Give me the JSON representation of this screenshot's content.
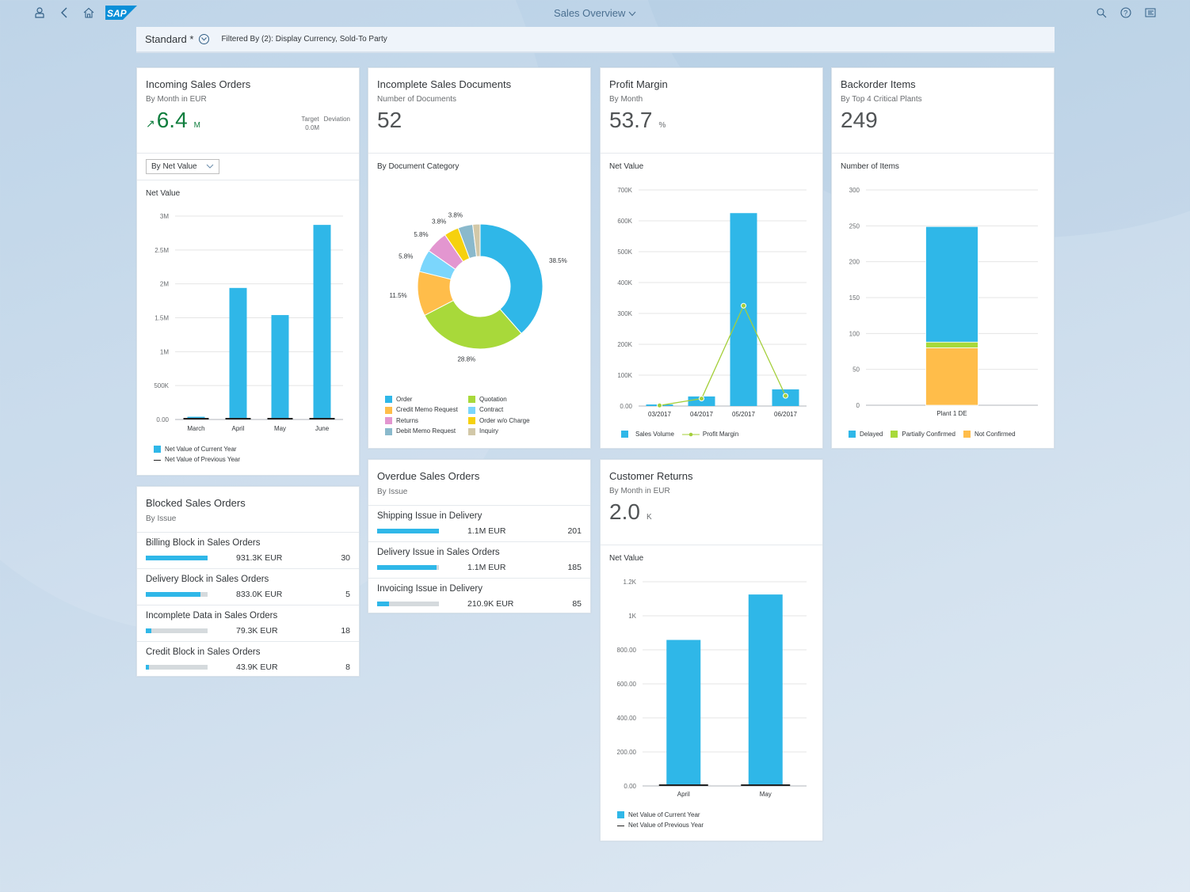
{
  "shell": {
    "title": "Sales Overview",
    "icons": [
      "user-icon",
      "back-icon",
      "home-icon",
      "search-icon",
      "help-icon",
      "notifications-icon"
    ],
    "logo": "SAP"
  },
  "filterbar": {
    "variant": "Standard *",
    "filtered_by": "Filtered By (2): Display Currency, Sold-To Party"
  },
  "colors": {
    "accent": "#2fb7e8",
    "positive": "#107e3e",
    "line_green": "#a4cf3a",
    "orange": "#ffbd4a"
  },
  "cards": {
    "incoming": {
      "title": "Incoming Sales Orders",
      "subtitle": "By Month in EUR",
      "kpi": "6.4",
      "unit": "M",
      "trend": "up",
      "target_label": "Target",
      "deviation_label": "Deviation",
      "target_value": "0.0M",
      "dropdown": "By Net Value",
      "chart_label": "Net Value",
      "legend_current": "Net Value of Current Year",
      "legend_previous": "Net Value of Previous Year"
    },
    "incomplete": {
      "title": "Incomplete Sales Documents",
      "subtitle": "Number of Documents",
      "kpi": "52",
      "chart_label": "By Document Category"
    },
    "profit": {
      "title": "Profit Margin",
      "subtitle": "By Month",
      "kpi": "53.7",
      "unit": "%",
      "chart_label": "Net Value"
    },
    "backorder": {
      "title": "Backorder Items",
      "subtitle": "By Top 4 Critical Plants",
      "kpi": "249",
      "chart_label": "Number of Items"
    },
    "blocked": {
      "title": "Blocked Sales Orders",
      "subtitle": "By Issue",
      "items": [
        {
          "label": "Billing Block in Sales Orders",
          "value": "931.3K EUR",
          "count": "30",
          "fraction": 1.0
        },
        {
          "label": "Delivery Block in Sales Orders",
          "value": "833.0K EUR",
          "count": "5",
          "fraction": 0.89
        },
        {
          "label": "Incomplete Data in Sales Orders",
          "value": "79.3K EUR",
          "count": "18",
          "fraction": 0.085
        },
        {
          "label": "Credit Block in Sales Orders",
          "value": "43.9K EUR",
          "count": "8",
          "fraction": 0.047
        }
      ]
    },
    "overdue": {
      "title": "Overdue Sales Orders",
      "subtitle": "By Issue",
      "items": [
        {
          "label": "Shipping Issue in Delivery",
          "value": "1.1M EUR",
          "count": "201",
          "fraction": 1.0
        },
        {
          "label": "Delivery Issue in Sales Orders",
          "value": "1.1M EUR",
          "count": "185",
          "fraction": 0.96
        },
        {
          "label": "Invoicing Issue in Delivery",
          "value": "210.9K EUR",
          "count": "85",
          "fraction": 0.19
        }
      ]
    },
    "returns": {
      "title": "Customer Returns",
      "subtitle": "By Month in EUR",
      "kpi": "2.0",
      "unit": "K",
      "chart_label": "Net Value",
      "legend_current": "Net Value of Current Year",
      "legend_previous": "Net Value of Previous Year"
    }
  },
  "chart_data": [
    {
      "id": "incoming",
      "type": "bar",
      "title": "Net Value",
      "categories": [
        "March",
        "April",
        "May",
        "June"
      ],
      "series": [
        {
          "name": "Net Value of Current Year",
          "values": [
            40000,
            1940000,
            1540000,
            2870000
          ],
          "color": "#2fb7e8"
        },
        {
          "name": "Net Value of Previous Year",
          "values": [
            0,
            0,
            0,
            0
          ],
          "color": "#222222"
        }
      ],
      "yticks": [
        "0.00",
        "500K",
        "1M",
        "1.5M",
        "2M",
        "2.5M",
        "3M"
      ],
      "ylim": [
        0,
        3000000
      ],
      "grid": true
    },
    {
      "id": "incomplete",
      "type": "pie",
      "title": "By Document Category",
      "slices": [
        {
          "name": "Order",
          "value": 38.5,
          "label": "38.5%",
          "color": "#2fb7e8"
        },
        {
          "name": "Quotation",
          "value": 28.8,
          "label": "28.8%",
          "color": "#a8d93a"
        },
        {
          "name": "Credit Memo Request",
          "value": 11.5,
          "label": "11.5%",
          "color": "#ffbd4a"
        },
        {
          "name": "Contract",
          "value": 5.8,
          "label": "5.8%",
          "color": "#7bd6fc"
        },
        {
          "name": "Returns",
          "value": 5.8,
          "label": "5.8%",
          "color": "#e396d0"
        },
        {
          "name": "Order w/o Charge",
          "value": 3.8,
          "label": "3.8%",
          "color": "#f6d10e"
        },
        {
          "name": "Debit Memo Request",
          "value": 3.8,
          "label": "3.8%",
          "color": "#8ab9cc"
        },
        {
          "name": "Inquiry",
          "value": 1.9,
          "label": "",
          "color": "#d2c8a8"
        }
      ],
      "legend_order": [
        "Order",
        "Quotation",
        "Credit Memo Request",
        "Contract",
        "Returns",
        "Order w/o Charge",
        "Debit Memo Request",
        "Inquiry"
      ],
      "donut": true
    },
    {
      "id": "profit",
      "type": "bar",
      "title": "Net Value",
      "categories": [
        "03/2017",
        "04/2017",
        "05/2017",
        "06/2017"
      ],
      "series": [
        {
          "name": "Sales Volume",
          "kind": "bar",
          "values": [
            5000,
            31000,
            625000,
            54000
          ],
          "color": "#2fb7e8"
        },
        {
          "name": "Profit Margin",
          "kind": "line",
          "values": [
            2000,
            24000,
            325000,
            33000
          ],
          "color": "#a4cf3a"
        }
      ],
      "yticks": [
        "0.00",
        "100K",
        "200K",
        "300K",
        "400K",
        "500K",
        "600K",
        "700K"
      ],
      "ylim": [
        0,
        700000
      ],
      "grid": true
    },
    {
      "id": "backorder",
      "type": "bar",
      "stacked": true,
      "title": "Number of Items",
      "categories": [
        "Plant 1 DE"
      ],
      "series": [
        {
          "name": "Not Confirmed",
          "values": [
            80
          ],
          "color": "#ffbd4a"
        },
        {
          "name": "Partially Confirmed",
          "values": [
            8
          ],
          "color": "#a8d93a"
        },
        {
          "name": "Delayed",
          "values": [
            161
          ],
          "color": "#2fb7e8"
        }
      ],
      "legend_order": [
        "Delayed",
        "Partially Confirmed",
        "Not Confirmed"
      ],
      "yticks": [
        "0",
        "50",
        "100",
        "150",
        "200",
        "250",
        "300"
      ],
      "ylim": [
        0,
        300
      ],
      "grid": true
    },
    {
      "id": "returns",
      "type": "bar",
      "title": "Net Value",
      "categories": [
        "April",
        "May"
      ],
      "series": [
        {
          "name": "Net Value of Current Year",
          "values": [
            858,
            1125
          ],
          "color": "#2fb7e8"
        },
        {
          "name": "Net Value of Previous Year",
          "values": [
            0,
            0
          ],
          "color": "#222222"
        }
      ],
      "yticks": [
        "0.00",
        "200.00",
        "400.00",
        "600.00",
        "800.00",
        "1K",
        "1.2K"
      ],
      "ylim": [
        0,
        1200
      ],
      "grid": true
    }
  ]
}
